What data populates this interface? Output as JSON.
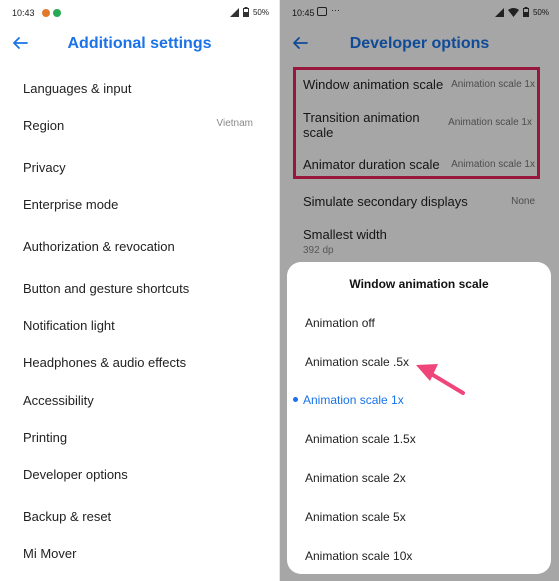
{
  "left": {
    "status": {
      "time": "10:43",
      "battery": "50%"
    },
    "title": "Additional settings",
    "items": [
      {
        "label": "Languages & input",
        "value": ""
      },
      {
        "label": "Region",
        "value": "Vietnam"
      },
      {
        "label": "Privacy",
        "value": ""
      },
      {
        "label": "Enterprise mode",
        "value": ""
      },
      {
        "label": "Authorization & revocation",
        "value": ""
      },
      {
        "label": "Button and gesture shortcuts",
        "value": ""
      },
      {
        "label": "Notification light",
        "value": ""
      },
      {
        "label": "Headphones & audio effects",
        "value": ""
      },
      {
        "label": "Accessibility",
        "value": ""
      },
      {
        "label": "Printing",
        "value": ""
      },
      {
        "label": "Developer options",
        "value": ""
      },
      {
        "label": "Backup & reset",
        "value": ""
      },
      {
        "label": "Mi Mover",
        "value": ""
      }
    ]
  },
  "right": {
    "status": {
      "time": "10:45",
      "battery": "50%"
    },
    "title": "Developer options",
    "items": [
      {
        "label": "Window animation scale",
        "value": "Animation scale 1x"
      },
      {
        "label": "Transition animation scale",
        "value": "Animation scale 1x"
      },
      {
        "label": "Animator duration scale",
        "value": "Animation scale 1x"
      },
      {
        "label": "Simulate secondary displays",
        "value": "None"
      },
      {
        "label": "Smallest width",
        "sub": "392 dp"
      }
    ],
    "dialog": {
      "title": "Window animation scale",
      "options": [
        "Animation off",
        "Animation scale .5x",
        "Animation scale 1x",
        "Animation scale 1.5x",
        "Animation scale 2x",
        "Animation scale 5x",
        "Animation scale 10x"
      ],
      "selected_index": 2
    }
  },
  "colors": {
    "accent": "#1a73e8",
    "highlight": "#e8265d",
    "arrow": "#f0457a"
  }
}
